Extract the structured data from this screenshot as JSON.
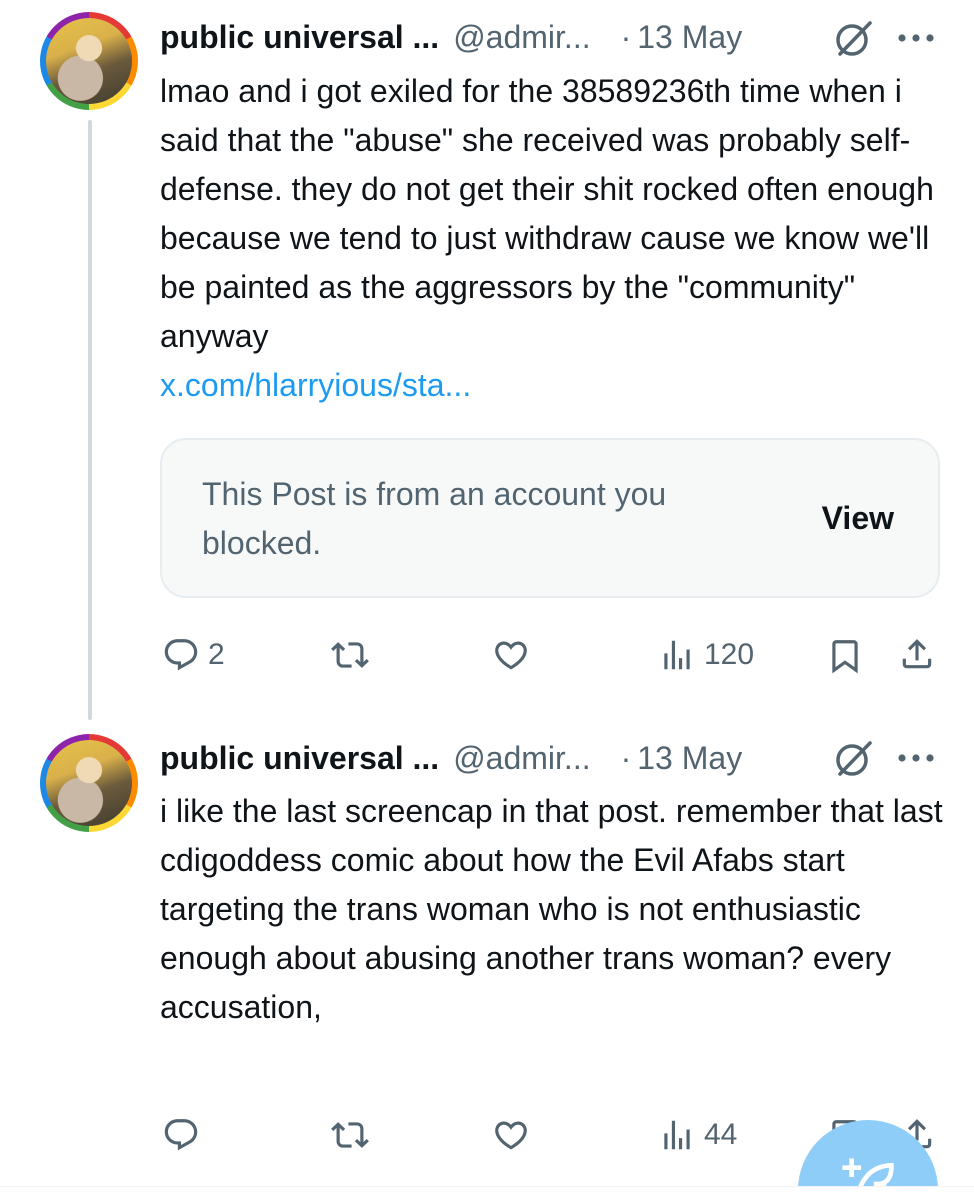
{
  "tweets": [
    {
      "display_name": "public universal ...",
      "handle": "@admir...",
      "separator": "·",
      "date": "13 May",
      "text": "lmao and i got exiled for the 38589236th time when i said that the \"abuse\" she received was probably self-defense. they do not get their shit rocked often enough because we tend to just withdraw cause we know we'll be painted as the aggressors by the \"community\" anyway",
      "link": "x.com/hlarryious/sta...",
      "quote": {
        "text": "This Post is from an account you blocked.",
        "action": "View"
      },
      "actions": {
        "replies": "2",
        "reposts": "",
        "likes": "",
        "views": "120"
      }
    },
    {
      "display_name": "public universal ...",
      "handle": "@admir...",
      "separator": "·",
      "date": "13 May",
      "text": "i like the last screencap in that post. remember that last cdigoddess comic about how the Evil Afabs start targeting the trans woman who is not enthusiastic enough about abusing another trans woman? every accusation,",
      "actions": {
        "replies": "",
        "reposts": "",
        "likes": "",
        "views": "44"
      }
    }
  ],
  "icons": {
    "muted_badge": "slashed-circle-icon",
    "more": "more-icon",
    "reply": "reply-icon",
    "repost": "repost-icon",
    "like": "like-icon",
    "views": "views-icon",
    "bookmark": "bookmark-icon",
    "share": "share-icon",
    "compose": "compose-icon"
  },
  "colors": {
    "text": "#0f1419",
    "secondary": "#536471",
    "link": "#1d9bf0",
    "thread_line": "#cfd9de",
    "quote_bg": "#f7f9f9",
    "fab": "#8ecdf8"
  }
}
